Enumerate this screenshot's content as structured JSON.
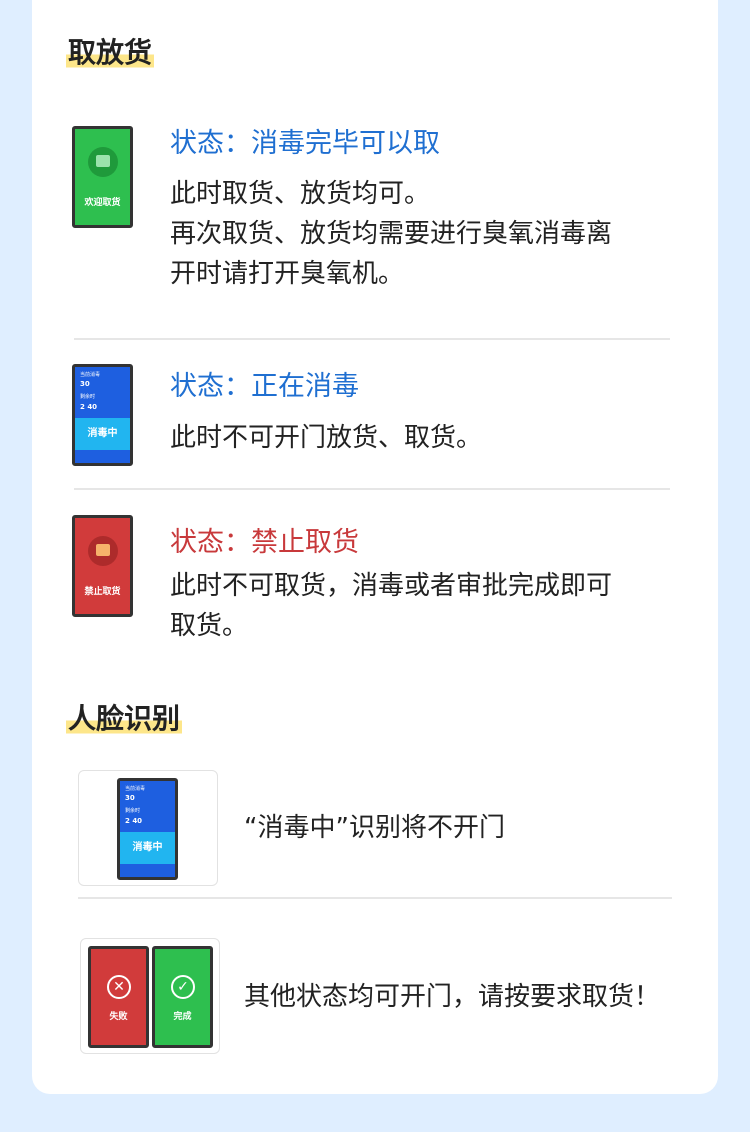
{
  "sections": {
    "pickup": {
      "title": "取放货",
      "items": [
        {
          "status": "状态：消毒完毕可以取",
          "desc_lines": [
            "此时取货、放货均可。",
            "再次取货、放货均需要进行臭氧消毒离",
            "开时请打开臭氧机。"
          ],
          "phone_label": "欢迎取货",
          "status_color": "#1f6fd1"
        },
        {
          "status": "状态：正在消毒",
          "desc_lines": [
            "此时不可开门放货、取货。"
          ],
          "phone_texts": [
            "当前消毒",
            "30",
            "剩余时",
            "2",
            "40",
            "消毒中"
          ],
          "status_color": "#1f6fd1"
        },
        {
          "status": "状态：禁止取货",
          "desc_lines": [
            "此时不可取货，消毒或者审批完成即可",
            "取货。"
          ],
          "phone_label": "禁止取货",
          "status_color": "#c8393b"
        }
      ]
    },
    "face": {
      "title": "人脸识别",
      "items": [
        {
          "text": "“消毒中”识别将不开门",
          "phone_texts": [
            "当前消毒",
            "30",
            "剩余时",
            "2",
            "40",
            "消毒中"
          ]
        },
        {
          "text": "其他状态均可开门，请按要求取货！",
          "fail_label": "失败",
          "ok_label": "完成"
        }
      ]
    }
  }
}
